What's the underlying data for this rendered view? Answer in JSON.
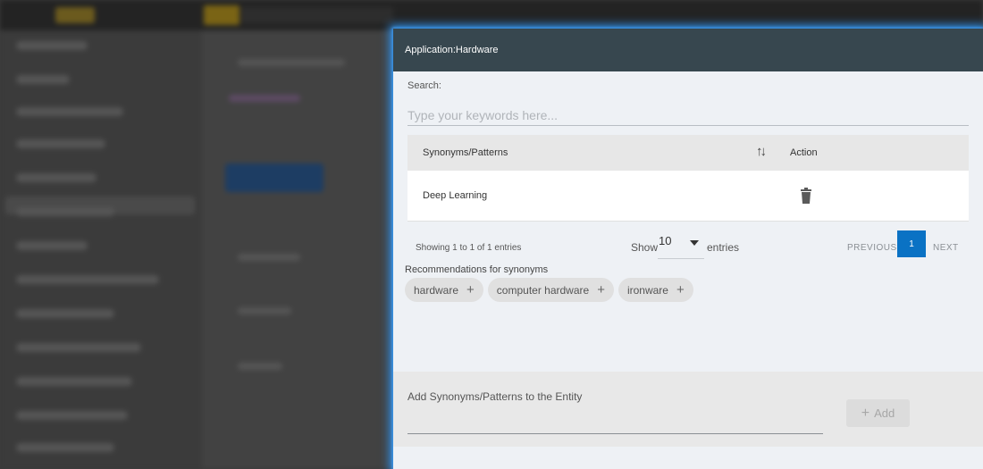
{
  "modal": {
    "title": "Application:Hardware"
  },
  "search": {
    "label": "Search:",
    "placeholder": "Type your keywords here..."
  },
  "table": {
    "headers": {
      "synonyms": "Synonyms/Patterns",
      "sort_icon": "sort-arrows-icon",
      "action": "Action"
    },
    "rows": [
      {
        "synonym": "Deep Learning",
        "action_icon": "trash-icon"
      }
    ]
  },
  "pagination": {
    "info": "Showing 1 to 1 of 1 entries",
    "show_label": "Show",
    "page_size": "10",
    "entries_label": "entries",
    "previous": "PREVIOUS",
    "current_page": "1",
    "next": "NEXT"
  },
  "recommendations": {
    "title": "Recommendations for synonyms",
    "chips": [
      {
        "label": "hardware"
      },
      {
        "label": "computer hardware"
      },
      {
        "label": "ironware"
      }
    ]
  },
  "add_section": {
    "label": "Add Synonyms/Patterns to the Entity",
    "button_label": "Add",
    "button_icon": "plus-icon"
  },
  "colors": {
    "header_bg": "#37474f",
    "accent": "#0a72c4",
    "modal_glow": "#2f8fe8"
  }
}
